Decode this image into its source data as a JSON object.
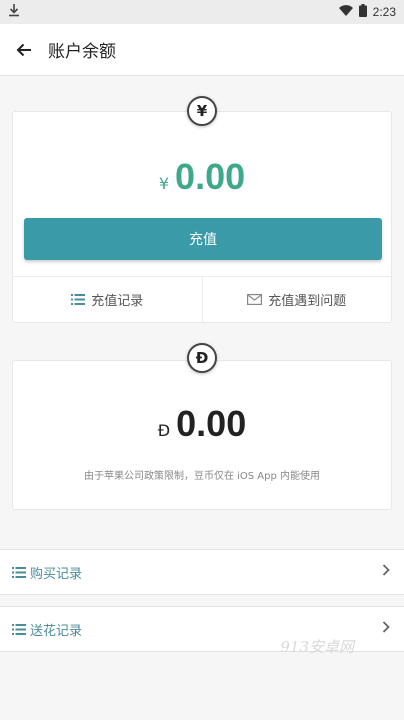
{
  "status_bar": {
    "time": "2:23"
  },
  "header": {
    "title": "账户余额"
  },
  "rmb_card": {
    "currency_symbol": "¥",
    "amount_symbol": "¥",
    "amount": "0.00",
    "charge_button": "充值",
    "links": [
      {
        "label": "充值记录",
        "icon": "list-icon"
      },
      {
        "label": "充值遇到问题",
        "icon": "mail-icon"
      }
    ]
  },
  "coin_card": {
    "currency_symbol": "Ɖ",
    "amount_symbol": "Ɖ",
    "amount": "0.00",
    "note": "由于苹果公司政策限制，豆币仅在 iOS App 内能使用"
  },
  "menu": [
    {
      "label": "购买记录"
    },
    {
      "label": "送花记录"
    }
  ],
  "watermark": "913安卓网",
  "colors": {
    "accent": "#3a9aa8",
    "amount_green": "#3da88a",
    "link_teal": "#4a8c99"
  }
}
